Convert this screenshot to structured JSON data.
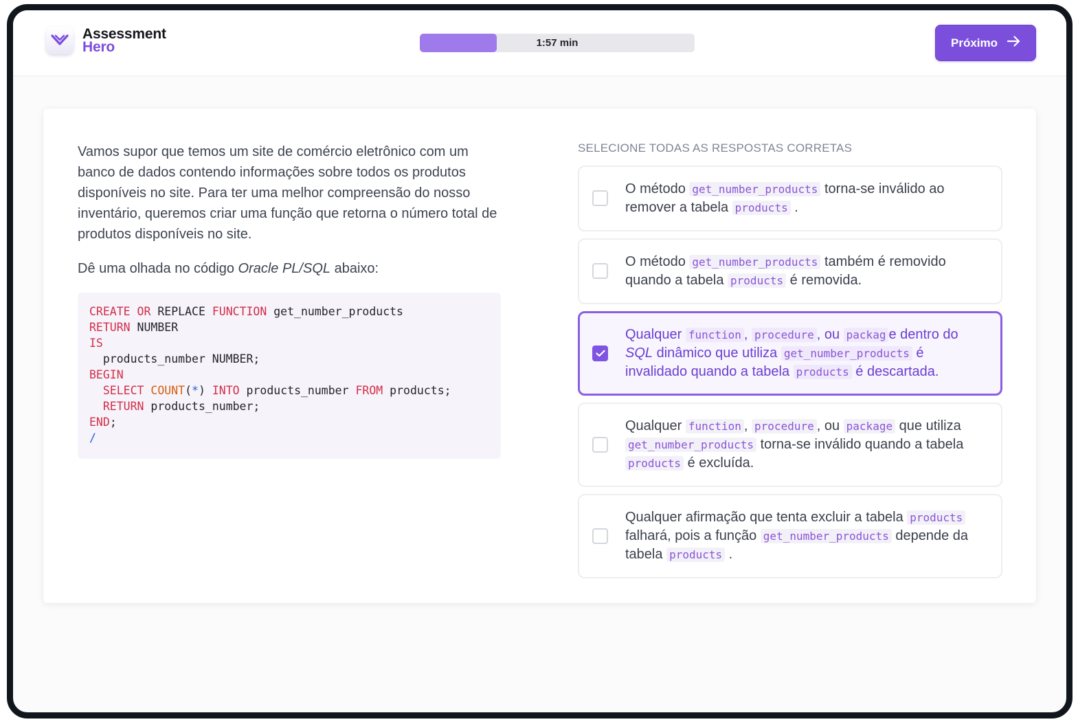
{
  "header": {
    "logo_line1": "Assessment",
    "logo_line2": "Hero",
    "timer_label": "1:57 min",
    "timer_progress": 0.28,
    "next_label": "Próximo"
  },
  "question": {
    "paragraph": "Vamos supor que temos um site de comércio eletrônico com um banco de dados contendo informações sobre todos os produtos disponíveis no site. Para ter uma melhor compreensão do nosso inventário, queremos criar uma função que retorna o número total de produtos disponíveis no site.",
    "prompt_before": "Dê uma olhada no código ",
    "prompt_em": "Oracle PL/SQL",
    "prompt_after": " abaixo:",
    "code": {
      "l1_kw1": "CREATE",
      "l1_kw2": "OR",
      "l1_t1": " REPLACE ",
      "l1_kw3": "FUNCTION",
      "l1_t2": " get_number_products",
      "l2_kw": "RETURN",
      "l2_t": " NUMBER",
      "l3_kw": "IS",
      "l4_t": "  products_number NUMBER;",
      "l5_kw": "BEGIN",
      "l6_kw1": "SELECT",
      "l6_fn": "COUNT",
      "l6_open": "(",
      "l6_star": "*",
      "l6_close": ")",
      "l6_kw2": "INTO",
      "l6_t1": " products_number ",
      "l6_kw3": "FROM",
      "l6_t2": " products;",
      "l7_kw": "RETURN",
      "l7_t": " products_number;",
      "l8_kw": "END",
      "l8_t": ";",
      "l9_op": "/"
    }
  },
  "answers": {
    "heading": "SELECIONE TODAS AS RESPOSTAS CORRETAS",
    "options": [
      {
        "checked": false,
        "t1": "O método ",
        "c1": "get_number_products",
        "t2": " torna-se inválido ao remover a tabela ",
        "c2": "products",
        "t3": " ."
      },
      {
        "checked": false,
        "t1": "O método ",
        "c1": "get_number_products",
        "t2": " também é removido quando a tabela ",
        "c2": "products",
        "t3": " é removida."
      },
      {
        "checked": true,
        "t1": "Qualquer ",
        "c1": "function",
        "t2": ", ",
        "c2": "procedure",
        "t3": ", ou ",
        "c3": "packag",
        "t4": "e dentro do ",
        "em": "SQL",
        "t5": " dinâmico que utiliza ",
        "c4": "get_number_products",
        "t6": " é invalidado quando a tabela ",
        "c5": "products",
        "t7": " é descartada."
      },
      {
        "checked": false,
        "t1": "Qualquer ",
        "c1": "function",
        "t2": ", ",
        "c2": "procedure",
        "t3": ", ou ",
        "c3": "package",
        "t4": " que utiliza ",
        "c4": "get_number_products",
        "t5": " torna-se inválido quando a tabela ",
        "c5": "products",
        "t6": " é excluída."
      },
      {
        "checked": false,
        "t1": "Qualquer afirmação que tenta excluir a tabela ",
        "c1": "products",
        "t2": " falhará, pois a função ",
        "c2": "get_number_products",
        "t3": " depende da tabela ",
        "c3": "products",
        "t4": " ."
      }
    ]
  },
  "colors": {
    "accent": "#7b4fdb",
    "timer_fill": "#9f7aea",
    "code_keyword": "#d22d49",
    "code_function": "#d4600f",
    "inline_code": "#8a55d8"
  },
  "icons": {
    "logo": "assessment-hero-logo-icon",
    "next": "arrow-right-icon",
    "check": "check-icon"
  }
}
